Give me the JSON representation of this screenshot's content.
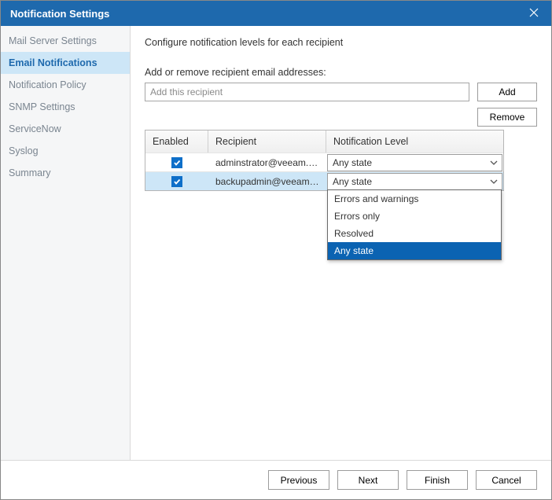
{
  "title": "Notification Settings",
  "sidebar": {
    "items": [
      {
        "label": "Mail Server Settings"
      },
      {
        "label": "Email Notifications"
      },
      {
        "label": "Notification Policy"
      },
      {
        "label": "SNMP Settings"
      },
      {
        "label": "ServiceNow"
      },
      {
        "label": "Syslog"
      },
      {
        "label": "Summary"
      }
    ],
    "active_index": 1
  },
  "main": {
    "description": "Configure notification levels for each recipient",
    "subtitle": "Add or remove recipient email addresses:",
    "input_placeholder": "Add this recipient",
    "add_label": "Add",
    "remove_label": "Remove",
    "columns": {
      "enabled": "Enabled",
      "recipient": "Recipient",
      "level": "Notification Level"
    },
    "rows": [
      {
        "enabled": true,
        "recipient": "adminstrator@veeam.com",
        "level": "Any state",
        "selected": false
      },
      {
        "enabled": true,
        "recipient": "backupadmin@veeam.co...",
        "level": "Any state",
        "selected": true
      }
    ],
    "dropdown": {
      "options": [
        "Errors and warnings",
        "Errors only",
        "Resolved",
        "Any state"
      ],
      "selected_index": 3
    }
  },
  "footer": {
    "previous": "Previous",
    "next": "Next",
    "finish": "Finish",
    "cancel": "Cancel"
  }
}
